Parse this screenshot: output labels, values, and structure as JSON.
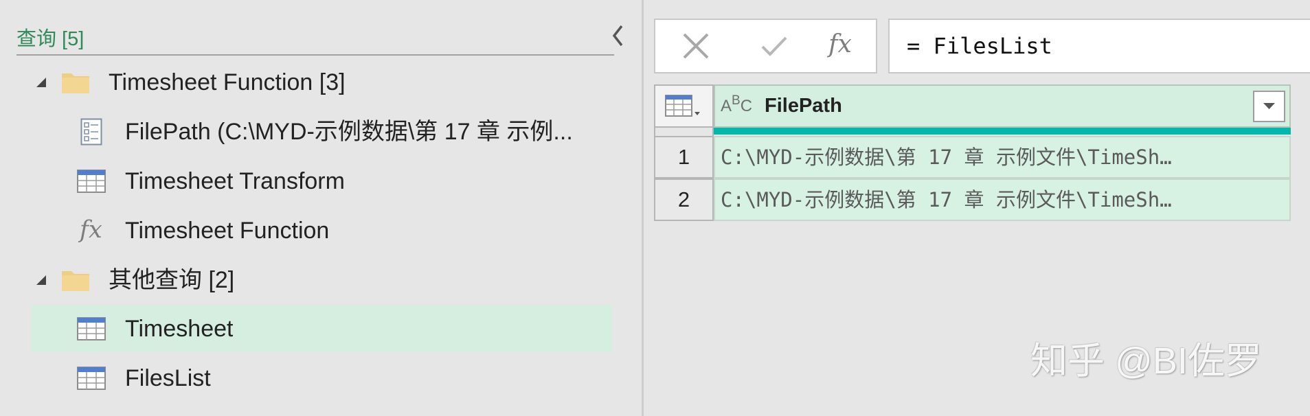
{
  "colors": {
    "pane_background": "#e6e6e6",
    "title_green": "#2f8a57",
    "selected_row": "#d5eee0",
    "column_header": "#d4eee0",
    "column_cells": "#d7f1e3",
    "quality_bar": "#01b8aa"
  },
  "queries_pane": {
    "title": "查询 [5]",
    "collapse_icon": "chevron-left-icon",
    "groups": [
      {
        "label": "Timesheet Function [3]",
        "expanded": true,
        "icon": "folder-icon",
        "items": [
          {
            "label": "FilePath (C:\\MYD-示例数据\\第 17 章 示例...",
            "icon": "parameter-icon",
            "selected": false
          },
          {
            "label": "Timesheet Transform",
            "icon": "table-icon",
            "selected": false
          },
          {
            "label": "Timesheet Function",
            "icon": "function-icon",
            "icon_text": "fx",
            "selected": false
          }
        ]
      },
      {
        "label": "其他查询 [2]",
        "expanded": true,
        "icon": "folder-icon",
        "items": [
          {
            "label": "Timesheet",
            "icon": "table-icon",
            "selected": true
          },
          {
            "label": "FilesList",
            "icon": "table-icon",
            "selected": false
          }
        ]
      }
    ]
  },
  "formula_bar": {
    "cancel_icon": "close-icon",
    "commit_icon": "check-icon",
    "function_icon": "function-icon",
    "function_icon_text": "fx",
    "formula": "= FilesList"
  },
  "preview_table": {
    "corner_icon": "table-menu-icon",
    "columns": [
      {
        "name": "FilePath",
        "type_icon": "text-type-icon",
        "type_icon_letters": [
          "A",
          "B",
          "C"
        ],
        "filter_icon": "dropdown-arrow-icon"
      }
    ],
    "rows": [
      {
        "row_number": "1",
        "cells": [
          "C:\\MYD-示例数据\\第 17 章 示例文件\\TimeSh…"
        ]
      },
      {
        "row_number": "2",
        "cells": [
          "C:\\MYD-示例数据\\第 17 章 示例文件\\TimeSh…"
        ]
      }
    ]
  },
  "watermark": "知乎 @BI佐罗"
}
